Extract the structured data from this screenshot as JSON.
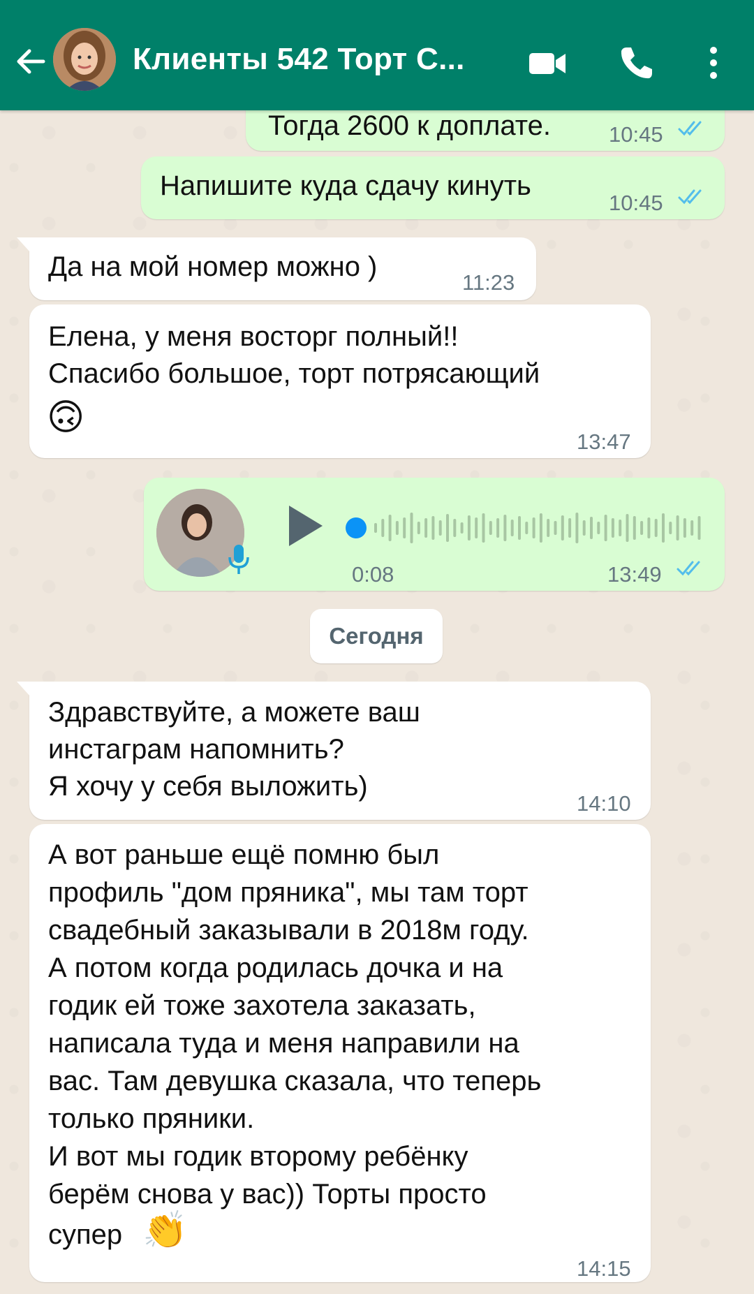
{
  "header": {
    "title": "Клиенты 542 Торт С...",
    "back_icon": "arrow-back-icon",
    "avatar": "contact-avatar",
    "video_icon": "video-call-icon",
    "call_icon": "phone-icon",
    "menu_icon": "more-vert-icon"
  },
  "messages": [
    {
      "direction": "out",
      "text": "Тогда 2600 к доплате.",
      "time": "10:45",
      "status": "read"
    },
    {
      "direction": "out",
      "text": "Напишите куда сдачу кинуть",
      "time": "10:45",
      "status": "read"
    },
    {
      "direction": "in",
      "text": "Да на мой номер можно )",
      "time": "11:23"
    },
    {
      "direction": "in",
      "lines": [
        "Елена, у меня восторг полный!!",
        "Спасибо большое, торт потрясающий"
      ],
      "emoji": "🙃",
      "time": "13:47"
    },
    {
      "direction": "out",
      "type": "voice",
      "duration": "0:08",
      "time": "13:49",
      "status": "read",
      "icons": [
        "voice-avatar",
        "mic-icon",
        "play-icon"
      ]
    },
    {
      "direction": "in",
      "lines": [
        "Здравствуйте, а можете ваш",
        "инстаграм напомнить?",
        "Я хочу у себя выложить)"
      ],
      "time": "14:10"
    },
    {
      "direction": "in",
      "lines": [
        "А вот раньше ещё помню был",
        "профиль \"дом пряника\", мы там торт",
        "свадебный заказывали в 2018м году.",
        "А потом когда родилась дочка и на",
        "годик ей тоже захотела заказать,",
        "написала туда и меня направили на",
        "вас. Там девушка сказала, что теперь",
        "только пряники.",
        "И вот мы годик второму ребёнку",
        "берём снова у вас)) Торты просто",
        "супер"
      ],
      "emoji": "👏",
      "time": "14:15"
    }
  ],
  "date_separator": "Сегодня",
  "colors": {
    "header_bg": "#008069",
    "chat_bg": "#efe7dd",
    "outgoing_bubble": "#d9fdd3",
    "incoming_bubble": "#ffffff",
    "read_ticks": "#53bdeb",
    "voice_dot": "#0b93f6",
    "time_text": "#667781"
  }
}
